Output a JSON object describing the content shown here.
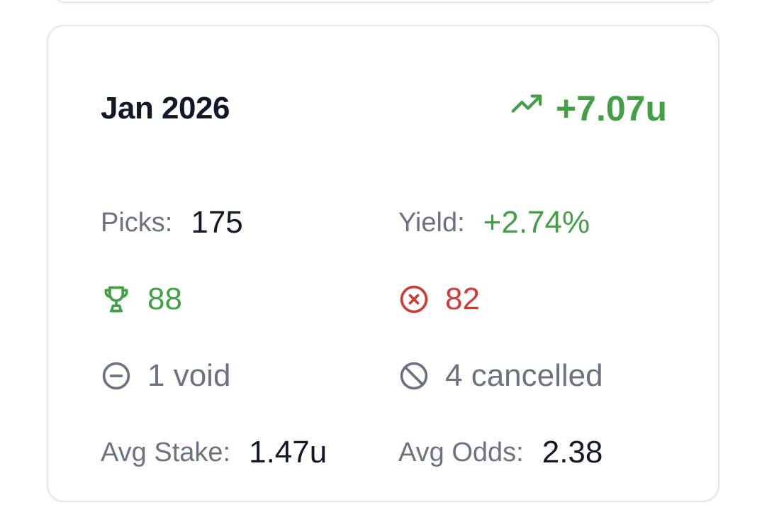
{
  "period": {
    "label": "Jan 2026",
    "profit": "+7.07u",
    "profit_icon": "trending-up-icon"
  },
  "stats": {
    "picks_label": "Picks:",
    "picks_value": "175",
    "yield_label": "Yield:",
    "yield_value": "+2.74%",
    "wins": "88",
    "wins_icon": "trophy-icon",
    "losses": "82",
    "losses_icon": "x-circle-icon",
    "void_text": "1 void",
    "void_icon": "minus-circle-icon",
    "cancelled_text": "4 cancelled",
    "cancelled_icon": "ban-icon",
    "avg_stake_label": "Avg Stake:",
    "avg_stake_value": "1.47u",
    "avg_odds_label": "Avg Odds:",
    "avg_odds_value": "2.38"
  },
  "colors": {
    "positive": "#43a047",
    "negative": "#d03a36",
    "muted": "#6b7280",
    "text": "#111827"
  }
}
